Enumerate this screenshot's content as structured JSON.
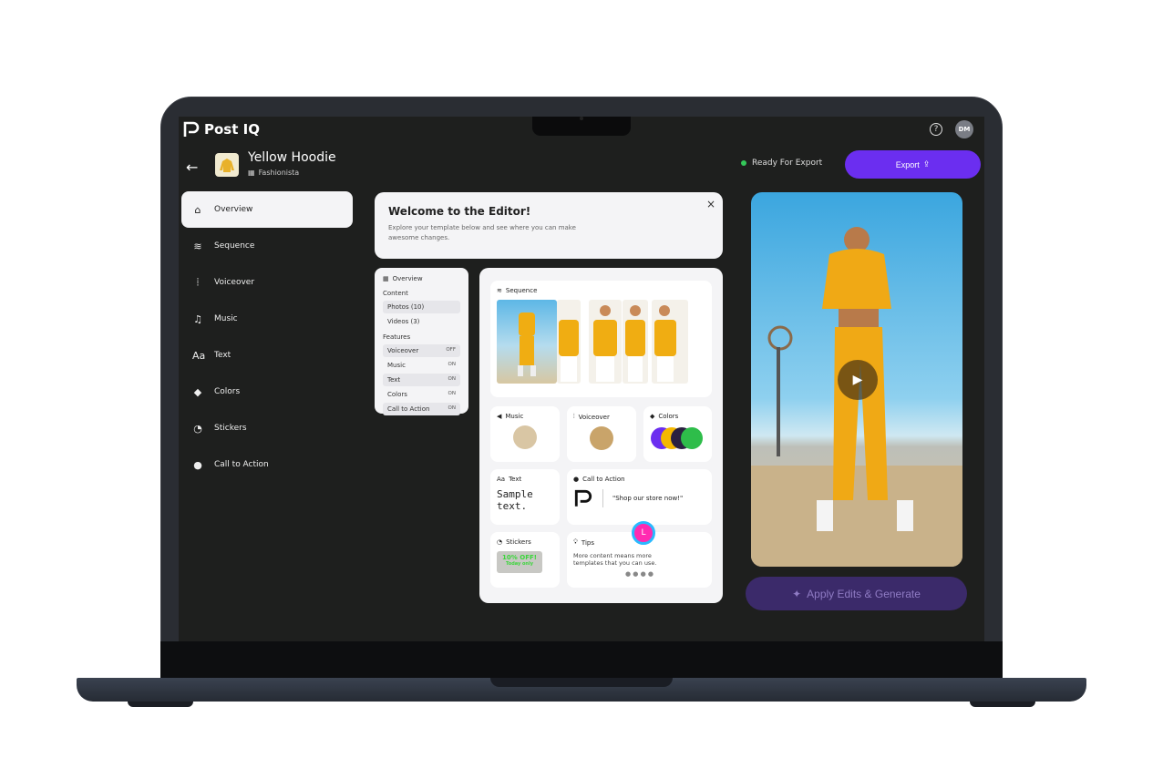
{
  "brand": {
    "name": "Post IQ"
  },
  "header": {
    "avatar": "DM",
    "help": "?",
    "back": "←"
  },
  "project": {
    "title": "Yellow Hoodie",
    "subtitle": "Fashionista"
  },
  "status": {
    "label": "Ready For Export",
    "color": "#34c759"
  },
  "export": {
    "label": "Export"
  },
  "nav": [
    {
      "label": "Overview",
      "icon": "home-icon",
      "glyph": "⌂",
      "active": true
    },
    {
      "label": "Sequence",
      "icon": "layers-icon",
      "glyph": "≋"
    },
    {
      "label": "Voiceover",
      "icon": "waveform-icon",
      "glyph": "⦙"
    },
    {
      "label": "Music",
      "icon": "music-note-icon",
      "glyph": "♫"
    },
    {
      "label": "Text",
      "icon": "text-aa-icon",
      "glyph": "Aa"
    },
    {
      "label": "Colors",
      "icon": "paint-bucket-icon",
      "glyph": "◆"
    },
    {
      "label": "Stickers",
      "icon": "sticker-icon",
      "glyph": "◔"
    },
    {
      "label": "Call to Action",
      "icon": "alert-bubble-icon",
      "glyph": "●"
    }
  ],
  "welcome": {
    "title": "Welcome to the Editor!",
    "body": "Explore your template below and see where you can make awesome changes.",
    "close": "×"
  },
  "overview": {
    "title": "Overview",
    "content_label": "Content",
    "content": [
      "Photos (10)",
      "Videos (3)"
    ],
    "features_label": "Features",
    "features": [
      {
        "name": "Voiceover",
        "state": "OFF"
      },
      {
        "name": "Music",
        "state": "ON"
      },
      {
        "name": "Text",
        "state": "ON"
      },
      {
        "name": "Colors",
        "state": "ON"
      },
      {
        "name": "Call to Action",
        "state": "ON"
      }
    ]
  },
  "tiles": {
    "sequence": "Sequence",
    "music": "Music",
    "voiceover": "Voiceover",
    "colors": "Colors",
    "text": "Text",
    "sample_text": "Sample text.",
    "cta": "Call to Action",
    "cta_text": "\"Shop our store now!\"",
    "stickers": "Stickers",
    "sticker_text": "10% OFF!",
    "sticker_sub": "Today only",
    "tips": "Tips",
    "tips_text": "More content means more templates that you can use."
  },
  "colors": {
    "accent": "#6b2ef0",
    "swatches": [
      "#6b2ef0",
      "#f5b800",
      "#2a2140",
      "#2ebd4a"
    ]
  },
  "cursor": {
    "initial": "L"
  },
  "generate": {
    "label": "Apply Edits & Generate"
  }
}
